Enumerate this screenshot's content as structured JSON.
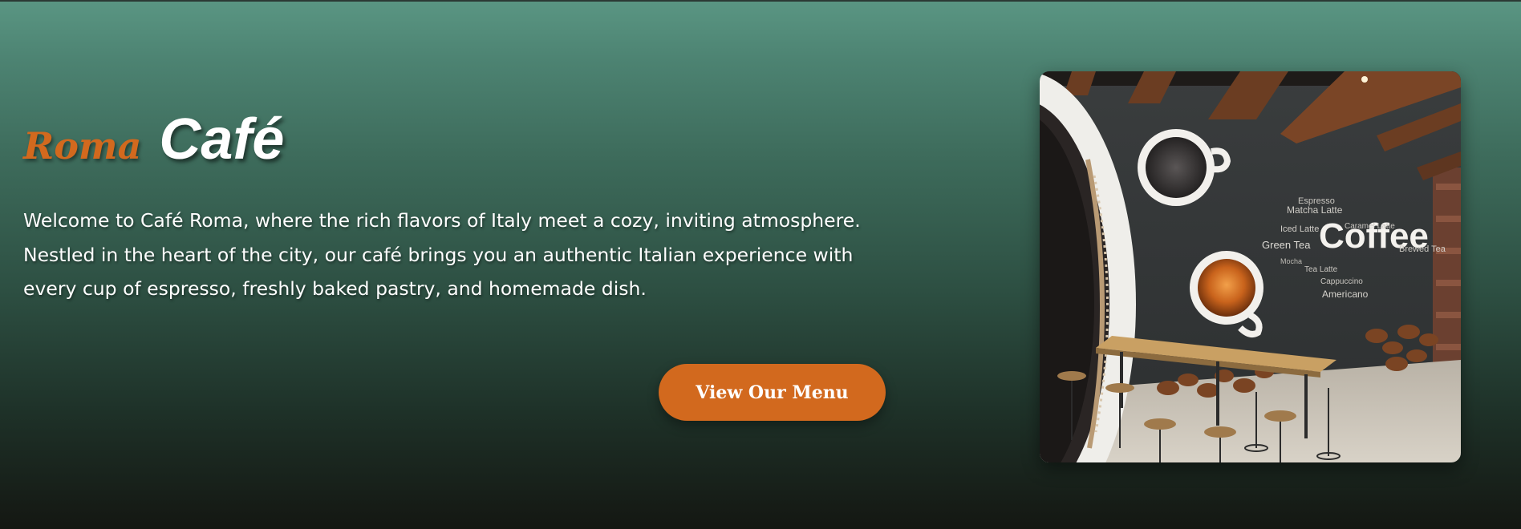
{
  "hero": {
    "title_accent": "Roma",
    "title_main": "Café",
    "description": "Welcome to Café Roma, where the rich flavors of Italy meet a cozy, inviting atmosphere. Nestled in the heart of the city, our café brings you an authentic Italian experience with every cup of espresso, freshly baked pastry, and homemade dish.",
    "button_label": "View Our Menu"
  },
  "image": {
    "alt": "Café interior with coffee-themed wall mural",
    "mural_words": {
      "big": "Coffee",
      "small": [
        "Espresso",
        "Matcha Latte",
        "Green Tea",
        "Iced Latte",
        "Caramel Latte",
        "Americano",
        "Brewed Tea",
        "Tea Latte",
        "Mocha",
        "Cappuccino"
      ]
    }
  },
  "colors": {
    "accent": "#d2691e",
    "text": "#ffffff",
    "bg_top": "#5a9683",
    "bg_bottom": "#141712"
  }
}
